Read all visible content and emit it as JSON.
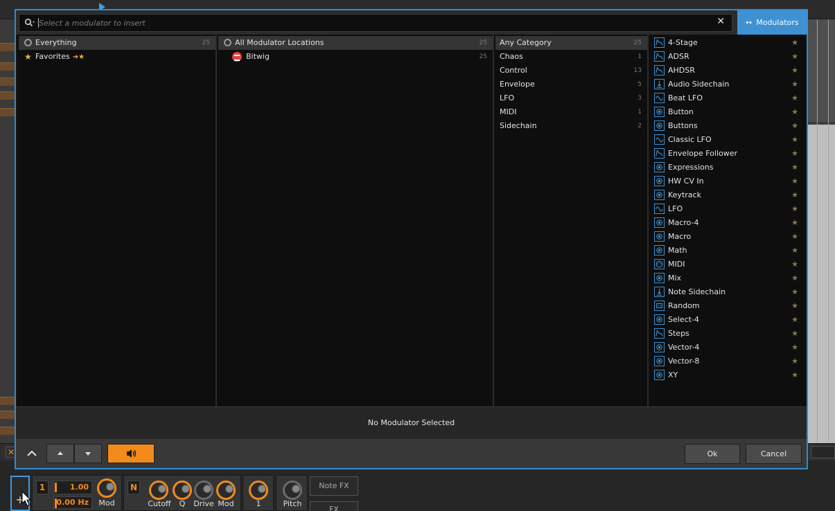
{
  "search": {
    "placeholder": "Select a modulator to insert",
    "clear_icon": "close-icon"
  },
  "tab": {
    "label": "Modulators"
  },
  "col_scope": {
    "items": [
      {
        "label": "Everything",
        "count": "25",
        "selected": true
      },
      {
        "label": "Favorites",
        "count": "",
        "suffix": "➜★"
      }
    ]
  },
  "col_location": {
    "items": [
      {
        "label": "All Modulator Locations",
        "count": "25",
        "selected": true
      },
      {
        "label": "Bitwig",
        "count": "25"
      }
    ]
  },
  "col_category": {
    "items": [
      {
        "label": "Any Category",
        "count": "25",
        "selected": true
      },
      {
        "label": "Chaos",
        "count": "1"
      },
      {
        "label": "Control",
        "count": "13"
      },
      {
        "label": "Envelope",
        "count": "5"
      },
      {
        "label": "LFO",
        "count": "3"
      },
      {
        "label": "MIDI",
        "count": "1"
      },
      {
        "label": "Sidechain",
        "count": "2"
      }
    ]
  },
  "modulators": [
    {
      "label": "4-Stage",
      "icon": "envelope-icon"
    },
    {
      "label": "ADSR",
      "icon": "envelope-icon"
    },
    {
      "label": "AHDSR",
      "icon": "envelope-icon"
    },
    {
      "label": "Audio Sidechain",
      "icon": "sidechain-icon"
    },
    {
      "label": "Beat LFO",
      "icon": "lfo-icon"
    },
    {
      "label": "Button",
      "icon": "control-icon"
    },
    {
      "label": "Buttons",
      "icon": "control-icon"
    },
    {
      "label": "Classic LFO",
      "icon": "lfo-icon"
    },
    {
      "label": "Envelope Follower",
      "icon": "envelope-icon"
    },
    {
      "label": "Expressions",
      "icon": "control-icon"
    },
    {
      "label": "HW CV In",
      "icon": "control-icon"
    },
    {
      "label": "Keytrack",
      "icon": "control-icon"
    },
    {
      "label": "LFO",
      "icon": "lfo-icon"
    },
    {
      "label": "Macro-4",
      "icon": "control-icon"
    },
    {
      "label": "Macro",
      "icon": "control-icon"
    },
    {
      "label": "Math",
      "icon": "control-icon"
    },
    {
      "label": "MIDI",
      "icon": "midi-icon"
    },
    {
      "label": "Mix",
      "icon": "control-icon"
    },
    {
      "label": "Note Sidechain",
      "icon": "sidechain-icon"
    },
    {
      "label": "Random",
      "icon": "chaos-icon"
    },
    {
      "label": "Select-4",
      "icon": "control-icon"
    },
    {
      "label": "Steps",
      "icon": "envelope-icon"
    },
    {
      "label": "Vector-4",
      "icon": "control-icon"
    },
    {
      "label": "Vector-8",
      "icon": "control-icon"
    },
    {
      "label": "XY",
      "icon": "control-icon"
    }
  ],
  "status": {
    "text": "No Modulator Selected"
  },
  "footer": {
    "ok_label": "Ok",
    "cancel_label": "Cancel"
  },
  "chain": {
    "device1_num": "1",
    "rate_value": "1.00",
    "freq_value": "0.00 Hz",
    "mod_label": "Mod",
    "note_badge": "N",
    "knobs": [
      "Cutoff",
      "Q",
      "Drive",
      "Mod"
    ],
    "knob_one_label": "1",
    "pitch_label": "Pitch",
    "note_fx_label": "Note FX",
    "fx_label": "FX"
  },
  "colors": {
    "accent": "#3e92d3",
    "orange": "#f28b1c",
    "star": "#f0b43c"
  }
}
